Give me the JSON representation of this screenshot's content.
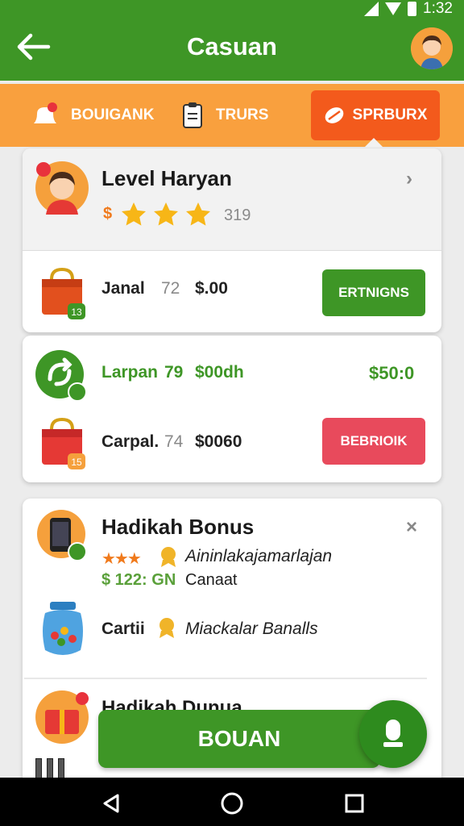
{
  "status": {
    "time": "1:32"
  },
  "header": {
    "title": "Casuan"
  },
  "tabs": [
    {
      "label": "BOUIGANK",
      "active": false
    },
    {
      "label": "TRURS",
      "active": false
    },
    {
      "label": "SPRBURX",
      "active": true
    }
  ],
  "card_level": {
    "title": "Level Haryan",
    "currency": "$",
    "stars": 3,
    "count": "319",
    "item": {
      "name": "Janal",
      "qty": "72",
      "price": "$.00",
      "badge": "13",
      "action": "ERTNIGNS"
    }
  },
  "card_items": [
    {
      "name": "Larpan",
      "qty": "79",
      "price": "$00dh",
      "right_price": "$50:0"
    },
    {
      "name": "Carpal.",
      "qty": "74",
      "price": "$0060",
      "badge": "15",
      "action": "BEBRIOIK"
    }
  ],
  "card_bonus": {
    "title": "Hadikah Bonus",
    "line1": "Aininlakajamarlajan",
    "price": "$ 122: GN",
    "line2": "Canaat",
    "item2_name": "Cartii",
    "item2_desc": "Miackalar Banalls",
    "partial_title": "Hadikah Dunua"
  },
  "bottom_button": {
    "label": "BOUAN"
  },
  "colors": {
    "primary": "#3e9626",
    "tabs": "#f9a03e",
    "tab_active": "#f35a1c",
    "danger": "#e84a5c"
  }
}
